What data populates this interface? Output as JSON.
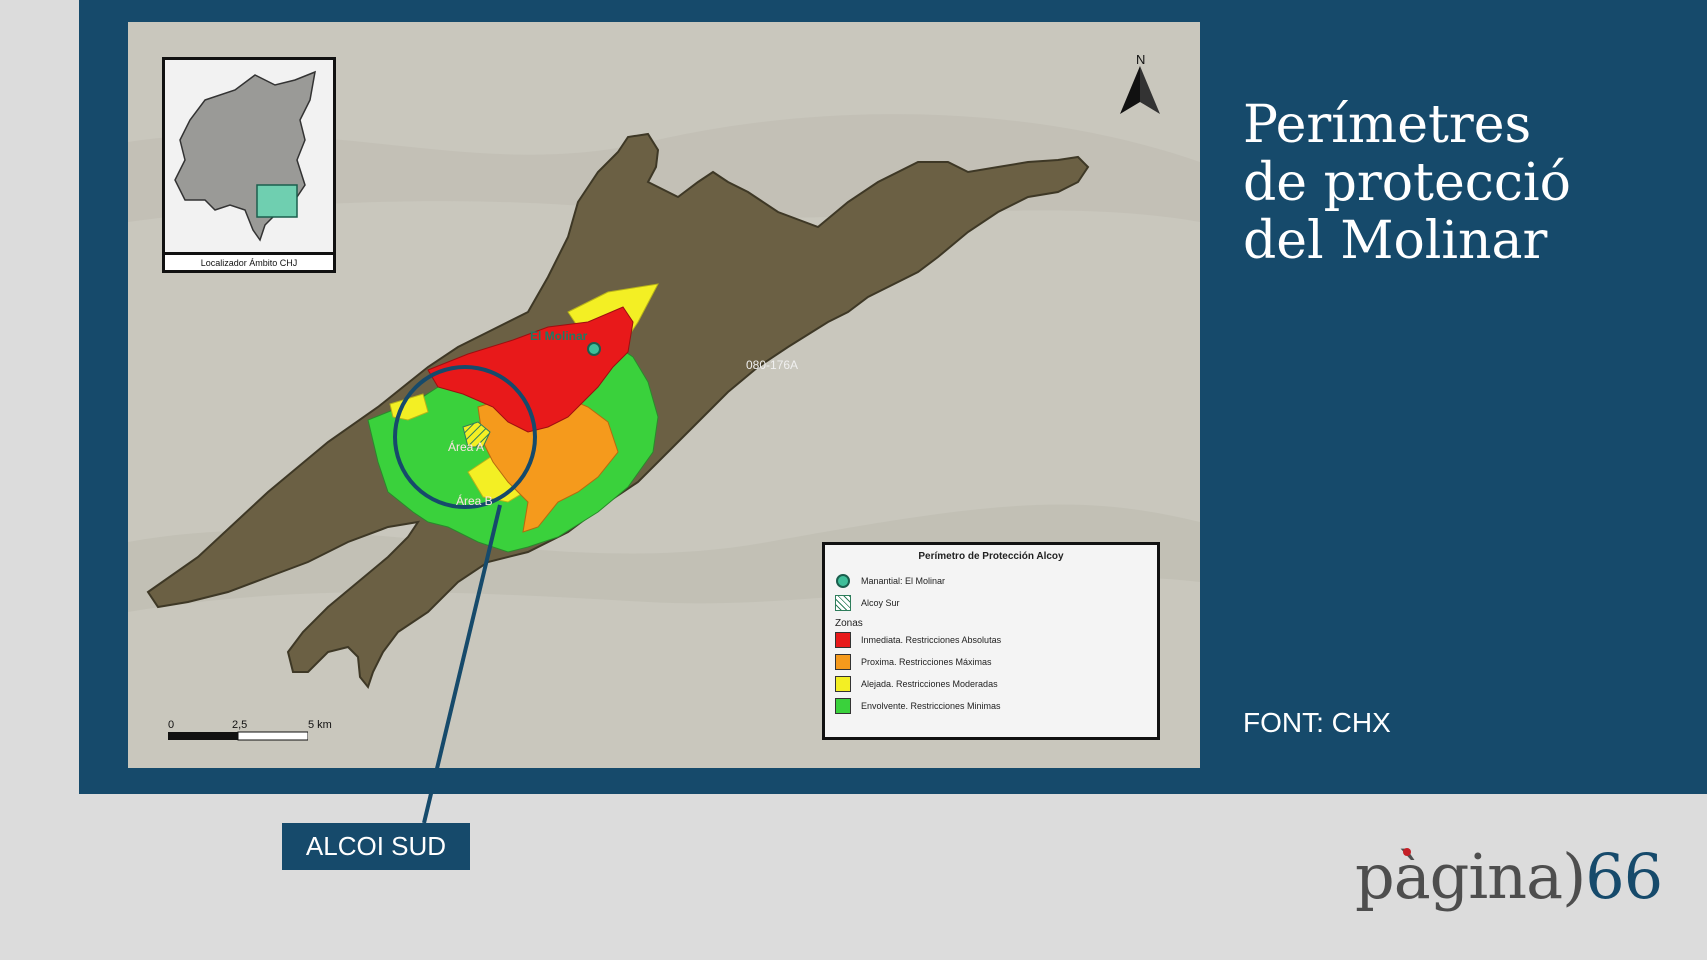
{
  "title_lines": [
    "Perímetres",
    "de protecció",
    "del Molinar"
  ],
  "source": "FONT: CHX",
  "callout": "ALCOI SUD",
  "logo": {
    "text": "pàgina",
    "bracket": ")",
    "number": "66"
  },
  "map": {
    "inset_caption": "Localizador Ámbito CHJ",
    "north_label": "N",
    "labels": {
      "spring": "El Molinar",
      "aquifer": "080-176A",
      "area_a": "Área A",
      "area_b": "Área B"
    },
    "scale": {
      "zero": "0",
      "mid": "2,5",
      "end": "5 km"
    },
    "legend": {
      "title": "Perímetro de Protección Alcoy",
      "spring": "Manantial: El Molinar",
      "alcoy_sur": "Alcoy Sur",
      "zones_title": "Zonas",
      "zones": [
        {
          "label": "Inmediata. Restricciones Absolutas",
          "color": "#e8191a"
        },
        {
          "label": "Proxima. Restricciones Máximas",
          "color": "#f59a1c"
        },
        {
          "label": "Alejada. Restricciones Moderadas",
          "color": "#f3ef24"
        },
        {
          "label": "Envolvente. Restricciones Minimas",
          "color": "#3ad13c"
        }
      ]
    }
  },
  "colors": {
    "panel": "#164a6b",
    "background": "#dcdcdc",
    "aquifer": "#6b6044",
    "spring": "#3fbf9a"
  }
}
